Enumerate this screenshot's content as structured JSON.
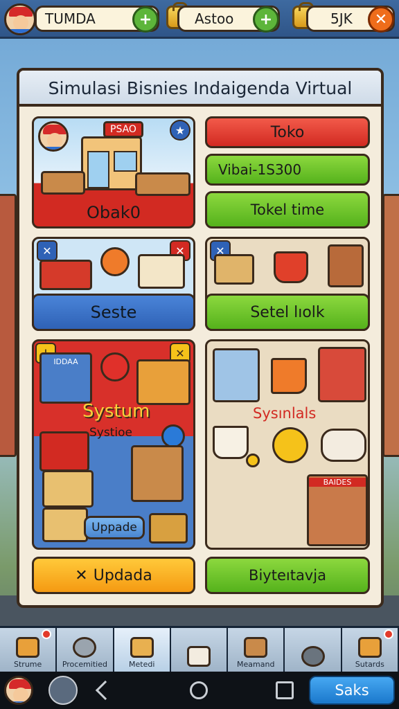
{
  "topbar": {
    "player_name": "TUMDA",
    "resource_label": "Astoo",
    "coins": "5JK"
  },
  "panel": {
    "title": "Simulasi Bisnies Indaigenda Virtual"
  },
  "shop_card": {
    "name": "Obak0",
    "sign": "PSAO"
  },
  "actions": {
    "toko": "Toko",
    "value": "Vibai-1S300",
    "ticket": "Tokel time"
  },
  "row2": {
    "seste": "Seste",
    "setel": "Setel lıolk"
  },
  "system_card": {
    "title": "Systum",
    "subtitle": "Systioe",
    "sign": "IDDAA",
    "upgrade": "Uppade"
  },
  "market_card": {
    "title": "Sysınlals",
    "sign": "BAIDES"
  },
  "bottom_buttons": {
    "update": "Updada",
    "business": "Biyteıtavja"
  },
  "tabs": [
    {
      "label": "Strume"
    },
    {
      "label": "Procemitied"
    },
    {
      "label": "Metedi"
    },
    {
      "label": ""
    },
    {
      "label": "Meamand"
    },
    {
      "label": ""
    },
    {
      "label": "Sutards"
    }
  ],
  "navbar": {
    "action": "Saks"
  }
}
